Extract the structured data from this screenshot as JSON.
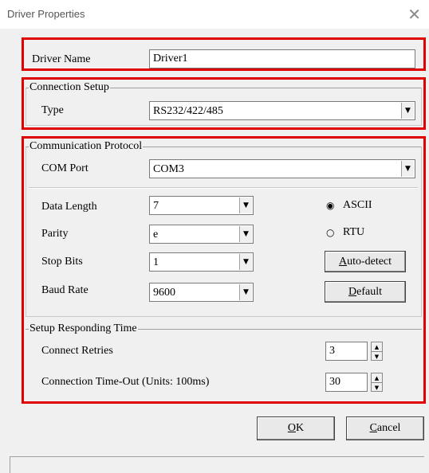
{
  "window": {
    "title": "Driver Properties",
    "close_glyph": "✕"
  },
  "driver": {
    "label": "Driver Name",
    "value": "Driver1"
  },
  "connection": {
    "legend": "Connection Setup",
    "type_label": "Type",
    "type_value": "RS232/422/485"
  },
  "protocol": {
    "legend": "Communication Protocol",
    "com_label": "COM Port",
    "com_value": "COM3",
    "data_length_label": "Data Length",
    "data_length_value": "7",
    "parity_label": "Parity",
    "parity_value": "e",
    "stop_bits_label": "Stop Bits",
    "stop_bits_value": "1",
    "baud_label": "Baud Rate",
    "baud_value": "9600",
    "mode_ascii": "ASCII",
    "mode_rtu": "RTU",
    "selected_mode": "ASCII",
    "autodetect_label": "Auto-detect",
    "default_label": "Default"
  },
  "responding": {
    "legend": "Setup Responding Time",
    "retries_label": "Connect Retries",
    "retries_value": "3",
    "timeout_label": "Connection Time-Out (Units: 100ms)",
    "timeout_value": "30"
  },
  "buttons": {
    "ok": "OK",
    "cancel": "Cancel"
  },
  "colors": {
    "highlight_border": "#e00000",
    "dialog_bg": "#f0f0f0"
  },
  "icons": {
    "dropdown": "dropdown-arrow-icon",
    "close": "close-icon",
    "spin_up": "spin-up-icon",
    "spin_down": "spin-down-icon"
  }
}
